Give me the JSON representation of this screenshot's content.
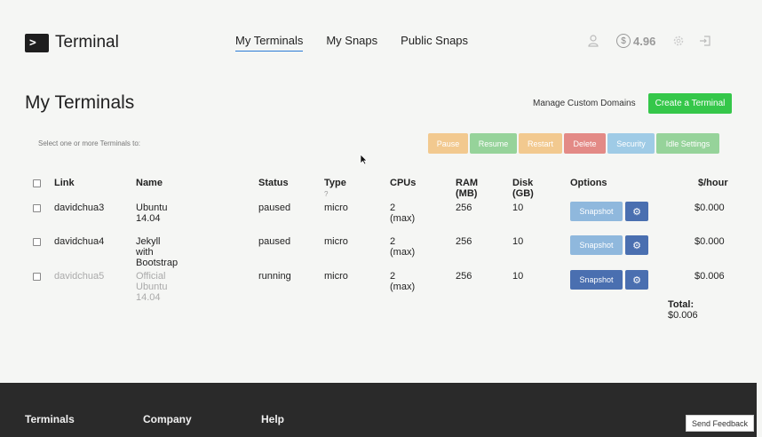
{
  "app": {
    "logo_glyph": ">",
    "logo_text": "Terminal"
  },
  "nav": {
    "items": [
      "My Terminals",
      "My Snaps",
      "Public Snaps"
    ],
    "active": "My Terminals"
  },
  "header": {
    "balance": "4.96",
    "icons": [
      "user-icon",
      "coin-icon",
      "gear-icon",
      "logout-icon"
    ]
  },
  "page": {
    "title": "My Terminals",
    "manage_link": "Manage Custom Domains",
    "create_button": "Create a Terminal",
    "select_hint": "Select one or more Terminals to:"
  },
  "actions": [
    {
      "label": "Pause",
      "color": "#f2c98f"
    },
    {
      "label": "Resume",
      "color": "#96d39a"
    },
    {
      "label": "Restart",
      "color": "#f2c98f"
    },
    {
      "label": "Delete",
      "color": "#e38a86"
    },
    {
      "label": "Security",
      "color": "#9fcbe6"
    },
    {
      "label": "Idle Settings",
      "color": "#96d39a"
    }
  ],
  "table": {
    "headers": [
      "Link",
      "Name",
      "Status",
      "Type",
      "CPUs",
      "RAM (MB)",
      "Disk (GB)",
      "Options",
      "$/hour"
    ],
    "type_help": "?",
    "rows": [
      {
        "link": "davidchua3",
        "name": "Ubuntu 14.04",
        "status": "paused",
        "type": "micro",
        "cpus": "2 (max)",
        "ram": "256",
        "disk": "10",
        "snapshot": "Snapshot",
        "price": "$0.000"
      },
      {
        "link": "davidchua4",
        "name": "Jekyll with Bootstrap",
        "status": "paused",
        "type": "micro",
        "cpus": "2 (max)",
        "ram": "256",
        "disk": "10",
        "snapshot": "Snapshot",
        "price": "$0.000"
      },
      {
        "link": "davidchua5",
        "name": "Official Ubuntu 14.04",
        "status": "running",
        "type": "micro",
        "cpus": "2 (max)",
        "ram": "256",
        "disk": "10",
        "snapshot": "Snapshot",
        "price": "$0.006"
      }
    ],
    "total_label": "Total:",
    "total_value": "$0.006"
  },
  "footer": {
    "columns": [
      "Terminals",
      "Company",
      "Help"
    ],
    "feedback": "Send Feedback"
  },
  "colors": {
    "accent_green": "#35c74a",
    "snapshot_paused": "#8fb8dd",
    "snapshot_running": "#4a6fb0",
    "gear_button": "#4a6fb0",
    "nav_underline": "#2b7bd6"
  }
}
